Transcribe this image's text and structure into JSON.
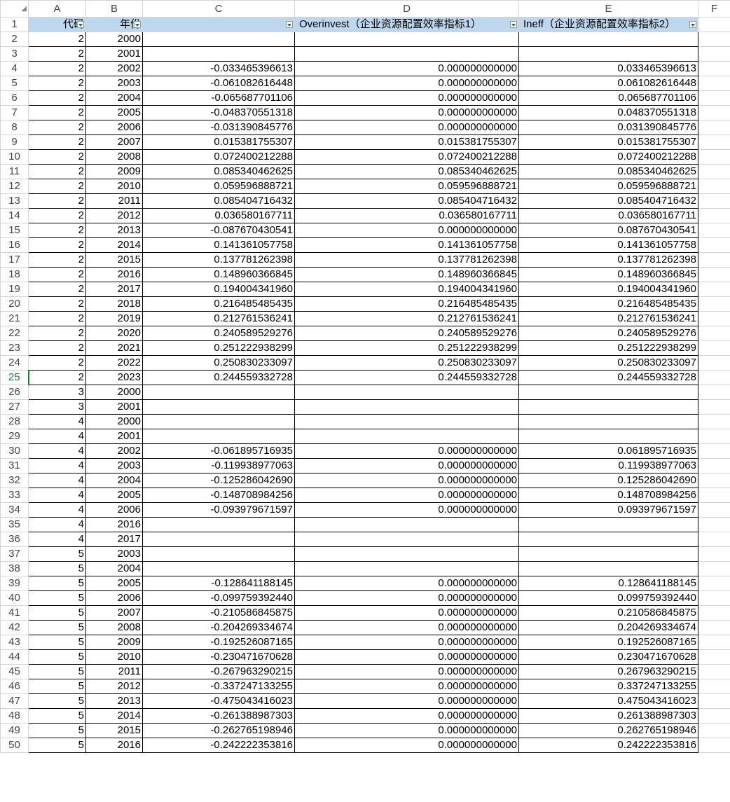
{
  "columns": [
    "A",
    "B",
    "C",
    "D",
    "E",
    "F"
  ],
  "header_row": {
    "row": "1",
    "a": "代码",
    "b": "年份",
    "c": "",
    "d": "Overinvest（企业资源配置效率指标1）",
    "e": "Ineff（企业资源配置效率指标2）"
  },
  "active_row": "25",
  "rows": [
    {
      "n": "2",
      "a": "2",
      "b": "2000",
      "c": "",
      "d": "",
      "e": ""
    },
    {
      "n": "3",
      "a": "2",
      "b": "2001",
      "c": "",
      "d": "",
      "e": ""
    },
    {
      "n": "4",
      "a": "2",
      "b": "2002",
      "c": "-0.033465396613",
      "d": "0.000000000000",
      "e": "0.033465396613"
    },
    {
      "n": "5",
      "a": "2",
      "b": "2003",
      "c": "-0.061082616448",
      "d": "0.000000000000",
      "e": "0.061082616448"
    },
    {
      "n": "6",
      "a": "2",
      "b": "2004",
      "c": "-0.065687701106",
      "d": "0.000000000000",
      "e": "0.065687701106"
    },
    {
      "n": "7",
      "a": "2",
      "b": "2005",
      "c": "-0.048370551318",
      "d": "0.000000000000",
      "e": "0.048370551318"
    },
    {
      "n": "8",
      "a": "2",
      "b": "2006",
      "c": "-0.031390845776",
      "d": "0.000000000000",
      "e": "0.031390845776"
    },
    {
      "n": "9",
      "a": "2",
      "b": "2007",
      "c": "0.015381755307",
      "d": "0.015381755307",
      "e": "0.015381755307"
    },
    {
      "n": "10",
      "a": "2",
      "b": "2008",
      "c": "0.072400212288",
      "d": "0.072400212288",
      "e": "0.072400212288"
    },
    {
      "n": "11",
      "a": "2",
      "b": "2009",
      "c": "0.085340462625",
      "d": "0.085340462625",
      "e": "0.085340462625"
    },
    {
      "n": "12",
      "a": "2",
      "b": "2010",
      "c": "0.059596888721",
      "d": "0.059596888721",
      "e": "0.059596888721"
    },
    {
      "n": "13",
      "a": "2",
      "b": "2011",
      "c": "0.085404716432",
      "d": "0.085404716432",
      "e": "0.085404716432"
    },
    {
      "n": "14",
      "a": "2",
      "b": "2012",
      "c": "0.036580167711",
      "d": "0.036580167711",
      "e": "0.036580167711"
    },
    {
      "n": "15",
      "a": "2",
      "b": "2013",
      "c": "-0.087670430541",
      "d": "0.000000000000",
      "e": "0.087670430541"
    },
    {
      "n": "16",
      "a": "2",
      "b": "2014",
      "c": "0.141361057758",
      "d": "0.141361057758",
      "e": "0.141361057758"
    },
    {
      "n": "17",
      "a": "2",
      "b": "2015",
      "c": "0.137781262398",
      "d": "0.137781262398",
      "e": "0.137781262398"
    },
    {
      "n": "18",
      "a": "2",
      "b": "2016",
      "c": "0.148960366845",
      "d": "0.148960366845",
      "e": "0.148960366845"
    },
    {
      "n": "19",
      "a": "2",
      "b": "2017",
      "c": "0.194004341960",
      "d": "0.194004341960",
      "e": "0.194004341960"
    },
    {
      "n": "20",
      "a": "2",
      "b": "2018",
      "c": "0.216485485435",
      "d": "0.216485485435",
      "e": "0.216485485435"
    },
    {
      "n": "21",
      "a": "2",
      "b": "2019",
      "c": "0.212761536241",
      "d": "0.212761536241",
      "e": "0.212761536241"
    },
    {
      "n": "22",
      "a": "2",
      "b": "2020",
      "c": "0.240589529276",
      "d": "0.240589529276",
      "e": "0.240589529276"
    },
    {
      "n": "23",
      "a": "2",
      "b": "2021",
      "c": "0.251222938299",
      "d": "0.251222938299",
      "e": "0.251222938299"
    },
    {
      "n": "24",
      "a": "2",
      "b": "2022",
      "c": "0.250830233097",
      "d": "0.250830233097",
      "e": "0.250830233097"
    },
    {
      "n": "25",
      "a": "2",
      "b": "2023",
      "c": "0.244559332728",
      "d": "0.244559332728",
      "e": "0.244559332728"
    },
    {
      "n": "26",
      "a": "3",
      "b": "2000",
      "c": "",
      "d": "",
      "e": ""
    },
    {
      "n": "27",
      "a": "3",
      "b": "2001",
      "c": "",
      "d": "",
      "e": ""
    },
    {
      "n": "28",
      "a": "4",
      "b": "2000",
      "c": "",
      "d": "",
      "e": ""
    },
    {
      "n": "29",
      "a": "4",
      "b": "2001",
      "c": "",
      "d": "",
      "e": ""
    },
    {
      "n": "30",
      "a": "4",
      "b": "2002",
      "c": "-0.061895716935",
      "d": "0.000000000000",
      "e": "0.061895716935"
    },
    {
      "n": "31",
      "a": "4",
      "b": "2003",
      "c": "-0.119938977063",
      "d": "0.000000000000",
      "e": "0.119938977063"
    },
    {
      "n": "32",
      "a": "4",
      "b": "2004",
      "c": "-0.125286042690",
      "d": "0.000000000000",
      "e": "0.125286042690"
    },
    {
      "n": "33",
      "a": "4",
      "b": "2005",
      "c": "-0.148708984256",
      "d": "0.000000000000",
      "e": "0.148708984256"
    },
    {
      "n": "34",
      "a": "4",
      "b": "2006",
      "c": "-0.093979671597",
      "d": "0.000000000000",
      "e": "0.093979671597"
    },
    {
      "n": "35",
      "a": "4",
      "b": "2016",
      "c": "",
      "d": "",
      "e": ""
    },
    {
      "n": "36",
      "a": "4",
      "b": "2017",
      "c": "",
      "d": "",
      "e": ""
    },
    {
      "n": "37",
      "a": "5",
      "b": "2003",
      "c": "",
      "d": "",
      "e": ""
    },
    {
      "n": "38",
      "a": "5",
      "b": "2004",
      "c": "",
      "d": "",
      "e": ""
    },
    {
      "n": "39",
      "a": "5",
      "b": "2005",
      "c": "-0.128641188145",
      "d": "0.000000000000",
      "e": "0.128641188145"
    },
    {
      "n": "40",
      "a": "5",
      "b": "2006",
      "c": "-0.099759392440",
      "d": "0.000000000000",
      "e": "0.099759392440"
    },
    {
      "n": "41",
      "a": "5",
      "b": "2007",
      "c": "-0.210586845875",
      "d": "0.000000000000",
      "e": "0.210586845875"
    },
    {
      "n": "42",
      "a": "5",
      "b": "2008",
      "c": "-0.204269334674",
      "d": "0.000000000000",
      "e": "0.204269334674"
    },
    {
      "n": "43",
      "a": "5",
      "b": "2009",
      "c": "-0.192526087165",
      "d": "0.000000000000",
      "e": "0.192526087165"
    },
    {
      "n": "44",
      "a": "5",
      "b": "2010",
      "c": "-0.230471670628",
      "d": "0.000000000000",
      "e": "0.230471670628"
    },
    {
      "n": "45",
      "a": "5",
      "b": "2011",
      "c": "-0.267963290215",
      "d": "0.000000000000",
      "e": "0.267963290215"
    },
    {
      "n": "46",
      "a": "5",
      "b": "2012",
      "c": "-0.337247133255",
      "d": "0.000000000000",
      "e": "0.337247133255"
    },
    {
      "n": "47",
      "a": "5",
      "b": "2013",
      "c": "-0.475043416023",
      "d": "0.000000000000",
      "e": "0.475043416023"
    },
    {
      "n": "48",
      "a": "5",
      "b": "2014",
      "c": "-0.261388987303",
      "d": "0.000000000000",
      "e": "0.261388987303"
    },
    {
      "n": "49",
      "a": "5",
      "b": "2015",
      "c": "-0.262765198946",
      "d": "0.000000000000",
      "e": "0.262765198946"
    },
    {
      "n": "50",
      "a": "5",
      "b": "2016",
      "c": "-0.242222353816",
      "d": "0.000000000000",
      "e": "0.242222353816"
    }
  ]
}
